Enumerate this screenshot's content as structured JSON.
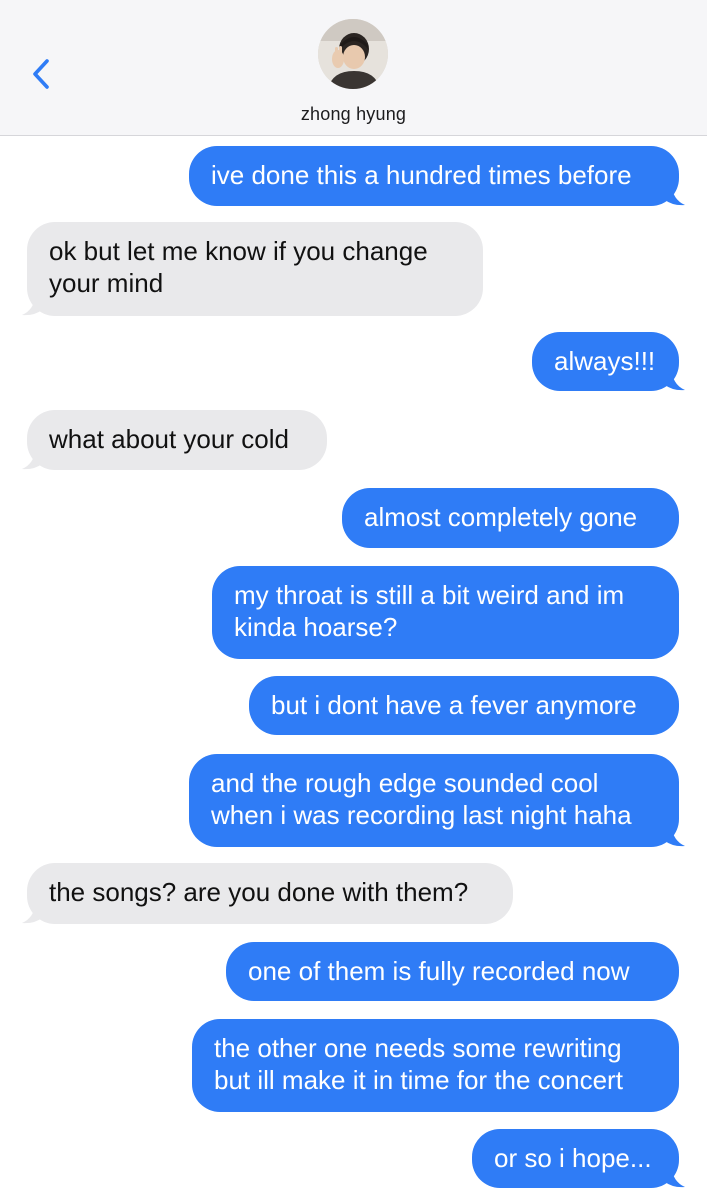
{
  "header": {
    "contact_name": "zhong hyung",
    "back_icon": "chevron-left-icon",
    "accent_color": "#2f7cf6"
  },
  "colors": {
    "sent_bubble": "#2f7cf6",
    "received_bubble": "#e9e9eb"
  },
  "messages": [
    {
      "from": "me",
      "text": "ive done this a hundred times before"
    },
    {
      "from": "them",
      "text": "ok but let me know if you change\nyour mind"
    },
    {
      "from": "me",
      "text": "always!!!"
    },
    {
      "from": "them",
      "text": "what about your cold"
    },
    {
      "from": "me",
      "text": "almost completely gone"
    },
    {
      "from": "me",
      "text": "my throat is still a bit weird and im\nkinda hoarse?"
    },
    {
      "from": "me",
      "text": "but i dont have a fever anymore"
    },
    {
      "from": "me",
      "text": "and the rough edge sounded cool\nwhen i was recording last night haha"
    },
    {
      "from": "them",
      "text": "the songs? are you done with them?"
    },
    {
      "from": "me",
      "text": "one of them is fully recorded now"
    },
    {
      "from": "me",
      "text": "the other one needs some rewriting\nbut ill make it in time for the concert"
    },
    {
      "from": "me",
      "text": "or so i hope..."
    }
  ]
}
